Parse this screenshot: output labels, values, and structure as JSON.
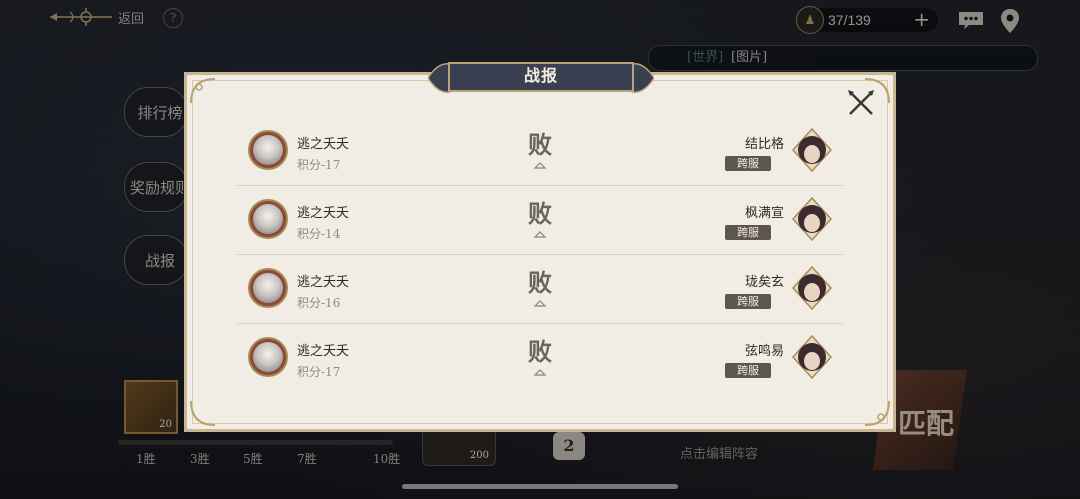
{
  "topbar": {
    "back_label": "返回",
    "help_label": "?",
    "stamina_value": "37/139",
    "stamina_plus": "+"
  },
  "chat": {
    "channel": "[世界]",
    "content": "[图片]"
  },
  "sidebar": {
    "items": [
      {
        "label": "排行榜"
      },
      {
        "label": "奖励规则"
      },
      {
        "label": "战报"
      }
    ]
  },
  "bottom": {
    "reward_count": "20",
    "card_count": "200",
    "win_labels": [
      "1胜",
      "3胜",
      "5胜",
      "7胜",
      "10胜"
    ],
    "lineup_count": "2",
    "edit_lineup_label": "点击编辑阵容",
    "match_label": "匹配"
  },
  "modal": {
    "title": "战报",
    "records": [
      {
        "player_name": "逃之夭夭",
        "score": "积分-17",
        "result": "败",
        "opponent_name": "结比格",
        "server": "跨服"
      },
      {
        "player_name": "逃之夭夭",
        "score": "积分-14",
        "result": "败",
        "opponent_name": "枫满宣",
        "server": "跨服"
      },
      {
        "player_name": "逃之夭夭",
        "score": "积分-16",
        "result": "败",
        "opponent_name": "珑矣玄",
        "server": "跨服"
      },
      {
        "player_name": "逃之夭夭",
        "score": "积分-17",
        "result": "败",
        "opponent_name": "弦鸣易",
        "server": "跨服"
      }
    ]
  },
  "colors": {
    "modal_bg": "#f1ede4",
    "title_plate": "#3a3f52",
    "gold_border": "#c9b690",
    "server_badge": "#5d564c"
  }
}
